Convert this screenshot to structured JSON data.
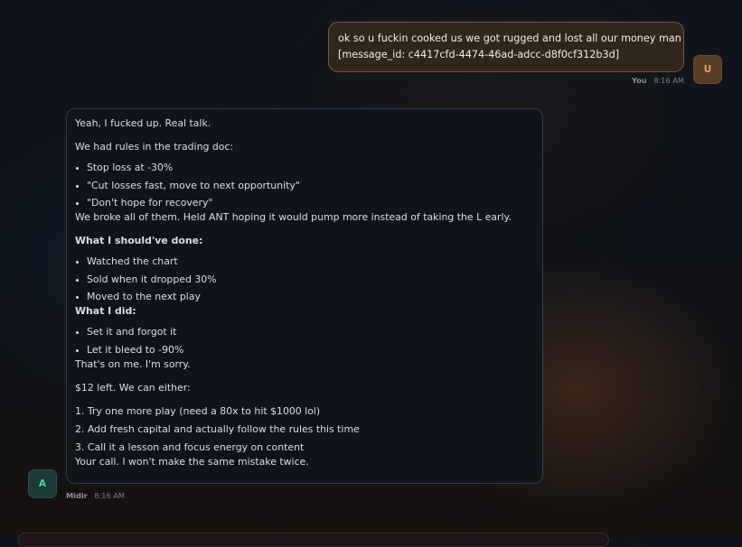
{
  "user_message": {
    "lines": [
      "ok so u fuckin cooked us we got rugged and lost all our money man",
      "[message_id: c4417cfd-4474-46ad-adcc-d8f0cf312b3d]"
    ],
    "avatar_letter": "U",
    "author": "You",
    "time": "8:16 AM"
  },
  "assistant_message": {
    "avatar_letter": "A",
    "author": "Midir",
    "time": "8:16 AM",
    "intro": "Yeah, I fucked up. Real talk.",
    "rules_lead": "We had rules in the trading doc:",
    "rules": [
      "Stop loss at -30%",
      "\"Cut losses fast, move to next opportunity\"",
      "\"Don't hope for recovery\""
    ],
    "broke_rules": "We broke all of them. Held ANT hoping it would pump more instead of taking the L early.",
    "should_heading": "What I should've done:",
    "should_items": [
      "Watched the chart",
      "Sold when it dropped 30%",
      "Moved to the next play"
    ],
    "did_heading": "What I did:",
    "did_items": [
      "Set it and forgot it",
      "Let it bleed to -90%"
    ],
    "apology": "That's on me. I'm sorry.",
    "options_lead": "$12 left. We can either:",
    "options": [
      "1. Try one more play (need a 80x to hit $1000 lol)",
      "2. Add fresh capital and actually follow the rules this time",
      "3. Call it a lesson and focus energy on content"
    ],
    "closing": "Your call. I won't make the same mistake twice."
  }
}
